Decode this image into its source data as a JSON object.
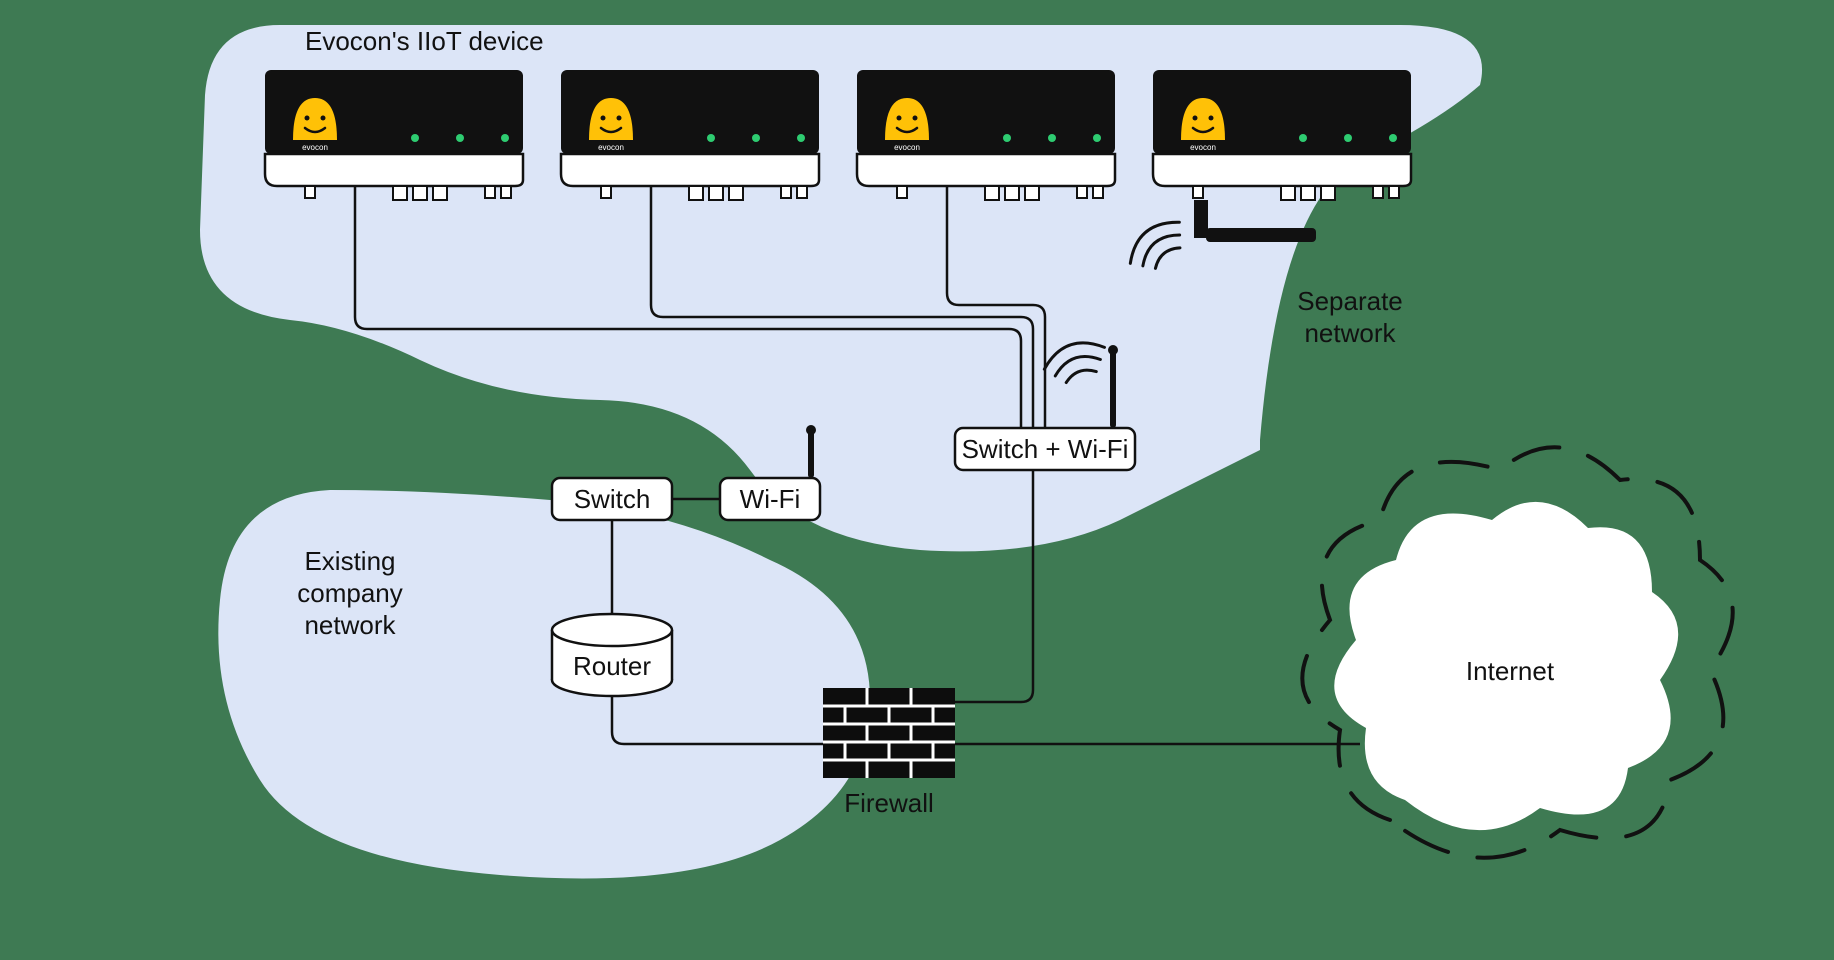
{
  "title": "Evocon's IIoT device",
  "labels": {
    "separate_network_1": "Separate",
    "separate_network_2": "network",
    "existing_1": "Existing",
    "existing_2": "company",
    "existing_3": "network",
    "switch": "Switch",
    "wifi": "Wi-Fi",
    "switch_wifi": "Switch + Wi-Fi",
    "router": "Router",
    "firewall": "Firewall",
    "internet": "Internet"
  },
  "device_brand": "evocon",
  "colors": {
    "bg": "#3e7a53",
    "region": "#dce5f7",
    "device_body": "#111111",
    "device_base": "#ffffff",
    "mascot": "#ffc107",
    "dot": "#2ecc71",
    "box_fill": "#ffffff",
    "firewall": "#0d0d0d"
  }
}
